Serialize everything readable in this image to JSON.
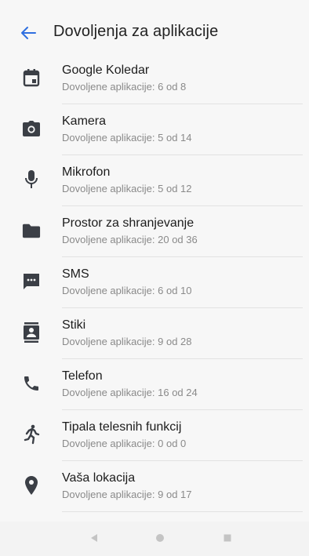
{
  "header": {
    "title": "Dovoljenja za aplikacije",
    "back_icon": "arrow-left-icon"
  },
  "accent": "#2f6fe0",
  "icon_color": "#3b3f46",
  "items": [
    {
      "label": "Google Koledar",
      "sub": "Dovoljene aplikacije: 6 od 8",
      "icon": "calendar-icon"
    },
    {
      "label": "Kamera",
      "sub": "Dovoljene aplikacije: 5 od 14",
      "icon": "camera-icon"
    },
    {
      "label": "Mikrofon",
      "sub": "Dovoljene aplikacije: 5 od 12",
      "icon": "microphone-icon"
    },
    {
      "label": "Prostor za shranjevanje",
      "sub": "Dovoljene aplikacije: 20 od 36",
      "icon": "folder-icon"
    },
    {
      "label": "SMS",
      "sub": "Dovoljene aplikacije: 6 od 10",
      "icon": "sms-icon"
    },
    {
      "label": "Stiki",
      "sub": "Dovoljene aplikacije: 9 od 28",
      "icon": "contacts-icon"
    },
    {
      "label": "Telefon",
      "sub": "Dovoljene aplikacije: 16 od 24",
      "icon": "phone-icon"
    },
    {
      "label": "Tipala telesnih funkcij",
      "sub": "Dovoljene aplikacije: 0 od 0",
      "icon": "body-sensors-icon"
    },
    {
      "label": "Vaša lokacija",
      "sub": "Dovoljene aplikacije: 9 od 17",
      "icon": "location-icon"
    }
  ],
  "navbar": {
    "back": "nav-back-icon",
    "home": "nav-home-icon",
    "recents": "nav-recents-icon"
  }
}
